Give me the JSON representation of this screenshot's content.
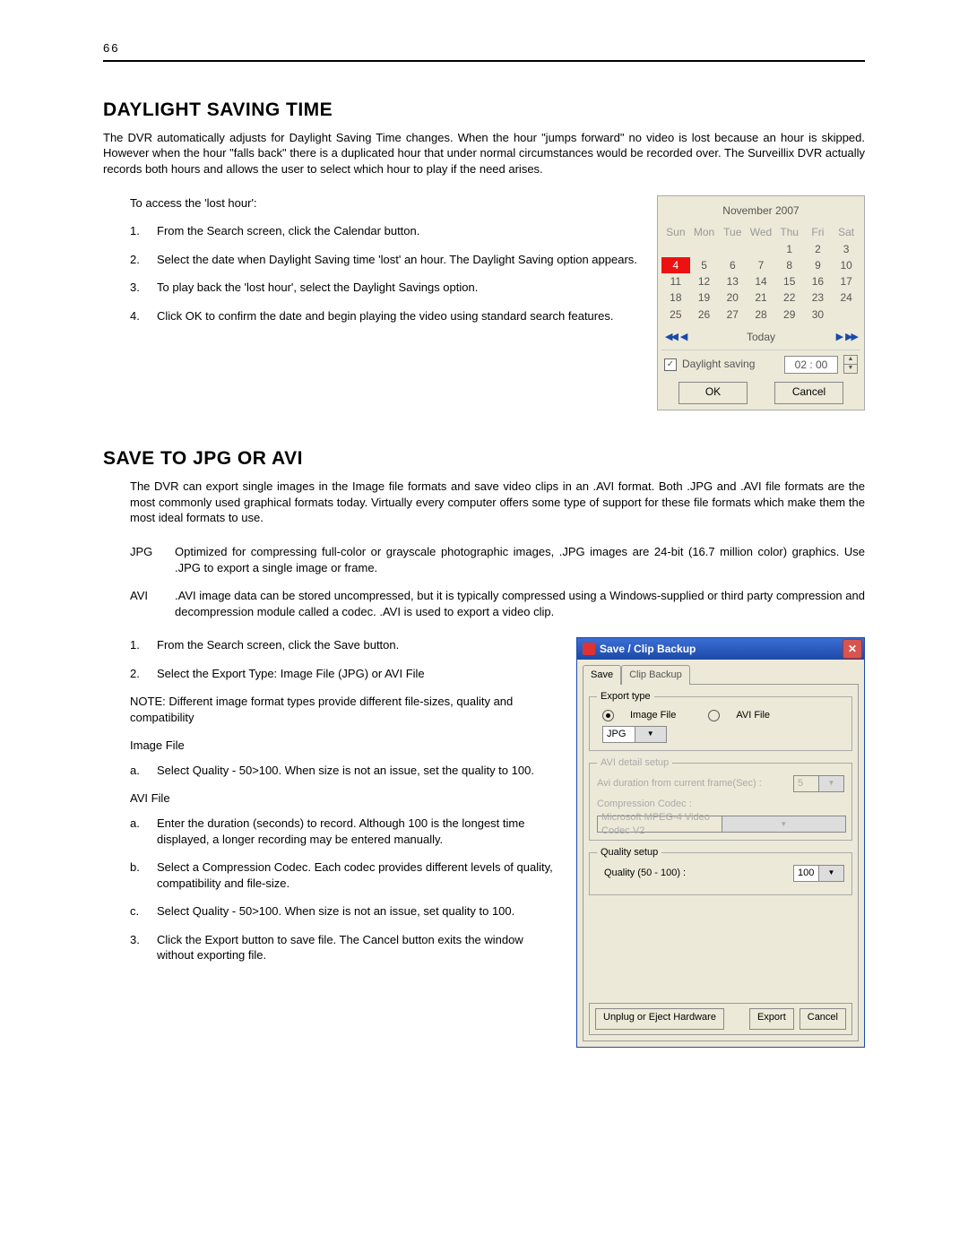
{
  "page_number": "66",
  "section1": {
    "heading": "DAYLIGHT SAVING TIME",
    "intro": "The DVR automatically adjusts for Daylight Saving Time changes.  When the hour \"jumps forward\" no video is lost because an hour is skipped.  However when the hour \"falls back\" there is a duplicated hour that under normal circumstances would be recorded over.  The Surveillix DVR actually records both hours and allows the user to select which hour to play if the need arises.",
    "lead": "To access the 'lost hour':",
    "steps": [
      "From the Search screen, click the Calendar button.",
      "Select the date when Daylight Saving time 'lost' an hour. The Daylight Saving option appears.",
      "To play back the 'lost hour', select the Daylight Savings option.",
      "Click OK to confirm the date and begin playing the video using standard search features."
    ]
  },
  "calendar": {
    "title": "November 2007",
    "weekdays": [
      "Sun",
      "Mon",
      "Tue",
      "Wed",
      "Thu",
      "Fri",
      "Sat"
    ],
    "rows": [
      [
        "",
        "",
        "",
        "",
        "1",
        "2",
        "3"
      ],
      [
        "4",
        "5",
        "6",
        "7",
        "8",
        "9",
        "10"
      ],
      [
        "11",
        "12",
        "13",
        "14",
        "15",
        "16",
        "17"
      ],
      [
        "18",
        "19",
        "20",
        "21",
        "22",
        "23",
        "24"
      ],
      [
        "25",
        "26",
        "27",
        "28",
        "29",
        "30",
        ""
      ]
    ],
    "selected": "4",
    "today_label": "Today",
    "daylight_label": "Daylight saving",
    "daylight_checked": true,
    "time_value": "02 : 00",
    "ok_label": "OK",
    "cancel_label": "Cancel"
  },
  "section2": {
    "heading": "SAVE TO JPG OR AVI",
    "intro": "The DVR can export single images in the Image file formats and save video clips in an .AVI format.  Both .JPG and .AVI file formats are the most commonly used graphical formats today.  Virtually every computer offers some type of support for these file formats which make them the most ideal formats to use.",
    "defs": [
      {
        "term": "JPG",
        "def": "Optimized for compressing full-color or grayscale photographic images, .JPG images are 24-bit (16.7 million color) graphics. Use .JPG to export a single image or frame."
      },
      {
        "term": "AVI",
        "def": ".AVI image data can be stored uncompressed, but it is typically compressed using a Windows-supplied or third party compression and decompression module called a codec.  .AVI is used to export a video clip."
      }
    ],
    "steps12": [
      "From the Search screen, click  the Save button.",
      "Select the Export Type: Image File (JPG) or AVI File"
    ],
    "note": "NOTE: Different image format types provide different file-sizes, quality and compatibility",
    "image_label": "Image File",
    "image_sub": [
      "Select Quality  - 50>100.   When size is not an issue, set the quality to 100."
    ],
    "avi_label": "AVI File",
    "avi_sub": [
      "Enter the duration (seconds) to record.  Although 100 is the longest time displayed, a longer recording may be entered manually.",
      "Select a Compression Codec.  Each codec provides different levels of quality, compatibility and file-size.",
      "Select Quality  - 50>100.   When size is not an issue, set quality to 100."
    ],
    "step3": "Click the Export button to save file.  The Cancel button exits the window without exporting file."
  },
  "dialog": {
    "title": "Save / Clip Backup",
    "tabs": [
      "Save",
      "Clip Backup"
    ],
    "export_legend": "Export type",
    "radio_image": "Image File",
    "radio_avi": "AVI File",
    "radio_selected": "image",
    "format_value": "JPG",
    "avi_legend": "AVI detail setup",
    "avi_duration_label": "Avi duration from current frame(Sec) :",
    "avi_duration_value": "5",
    "codec_label": "Compression Codec :",
    "codec_value": "Microsoft MPEG-4 Video Codec V2",
    "quality_legend": "Quality setup",
    "quality_label": "Quality (50 - 100) :",
    "quality_value": "100",
    "unplug_label": "Unplug or Eject Hardware",
    "export_label": "Export",
    "cancel_label": "Cancel"
  }
}
